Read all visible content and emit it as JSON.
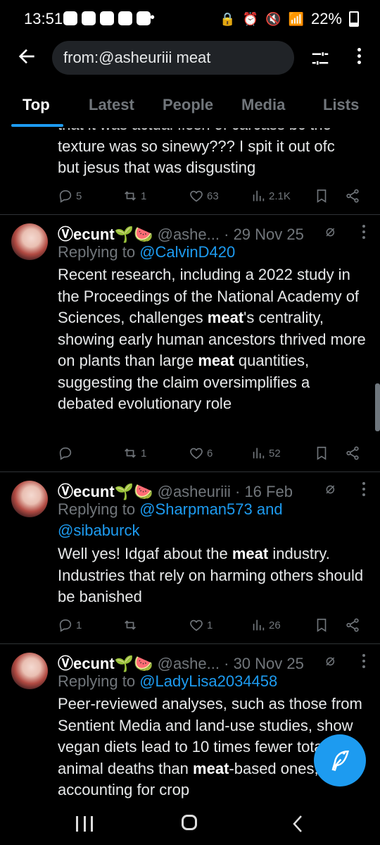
{
  "status_bar": {
    "time": "13:51",
    "battery": "22%",
    "dot": "•"
  },
  "search": {
    "query": "from:@asheuriii meat"
  },
  "tabs": [
    "Top",
    "Latest",
    "People",
    "Media",
    "Lists"
  ],
  "partial_tweet": {
    "lines": [
      "that it was actual flesh of carcass bc the",
      "texture was so sinewy??? I spit it out ofc",
      "but jesus that was disgusting"
    ],
    "replies": "5",
    "reposts": "1",
    "likes": "63",
    "views": "2.1K"
  },
  "tweets": [
    {
      "name": "Ⓥecunt",
      "emoji": "🌱🍉",
      "handle": "@ashe...",
      "date": "· 29 Nov 25",
      "replying_to_label": "Replying to",
      "mentions": "@CalvinD420",
      "body_html": "Recent research, including a 2022 study in the Proceedings of the National Academy of Sciences, challenges <b>meat</b>'s centrality, showing early human ancestors thrived more on plants than large <b>meat</b> quantities, suggesting the claim oversimplifies a debated evolutionary role",
      "replies": "",
      "reposts": "1",
      "likes": "6",
      "views": "52"
    },
    {
      "name": "Ⓥecunt",
      "emoji": "🌱🍉",
      "handle": "@asheuriii",
      "date": "· 16 Feb",
      "replying_to_label": "Replying to",
      "mentions": "@Sharpman573 and",
      "mentions_line2": "@sibaburck",
      "body_html": "Well yes! Idgaf about the <b>meat</b> industry. Industries that rely on harming others should be banished",
      "replies": "1",
      "reposts": "",
      "likes": "1",
      "views": "26"
    },
    {
      "name": "Ⓥecunt",
      "emoji": "🌱🍉",
      "handle": "@ashe...",
      "date": "· 30 Nov 25",
      "replying_to_label": "Replying to",
      "mentions": "@LadyLisa2034458",
      "body_html": "Peer-reviewed analyses, such as those from Sentient Media and land-use studies, show vegan diets lead to 10 times fewer total animal deaths than <b>meat</b>-based ones, accounting for crop"
    }
  ],
  "colors": {
    "accent": "#1d9bf0",
    "muted": "#71767b",
    "background": "#000000",
    "separator": "#2f3336"
  }
}
